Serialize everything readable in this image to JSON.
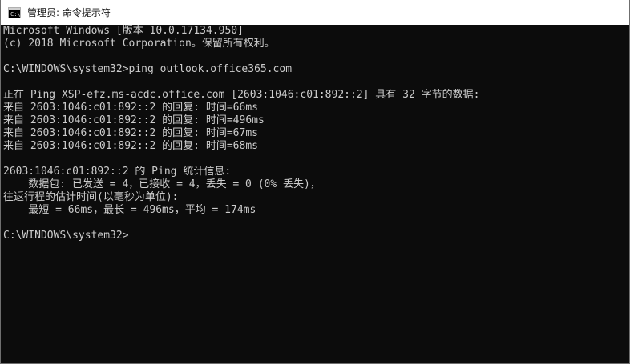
{
  "window": {
    "title": "管理员: 命令提示符",
    "icon": "cmd-icon"
  },
  "console": {
    "lines": [
      "Microsoft Windows [版本 10.0.17134.950]",
      "(c) 2018 Microsoft Corporation。保留所有权利。",
      "",
      "C:\\WINDOWS\\system32>ping outlook.office365.com",
      "",
      "正在 Ping XSP-efz.ms-acdc.office.com [2603:1046:c01:892::2] 具有 32 字节的数据:",
      "来自 2603:1046:c01:892::2 的回复: 时间=66ms",
      "来自 2603:1046:c01:892::2 的回复: 时间=496ms",
      "来自 2603:1046:c01:892::2 的回复: 时间=67ms",
      "来自 2603:1046:c01:892::2 的回复: 时间=68ms",
      "",
      "2603:1046:c01:892::2 的 Ping 统计信息:",
      "    数据包: 已发送 = 4，已接收 = 4，丢失 = 0 (0% 丢失)，",
      "往返行程的估计时间(以毫秒为单位):",
      "    最短 = 66ms，最长 = 496ms，平均 = 174ms",
      "",
      "C:\\WINDOWS\\system32>"
    ]
  },
  "colors": {
    "console_bg": "#0c0c0c",
    "console_fg": "#cccccc",
    "titlebar_bg": "#ffffff"
  }
}
